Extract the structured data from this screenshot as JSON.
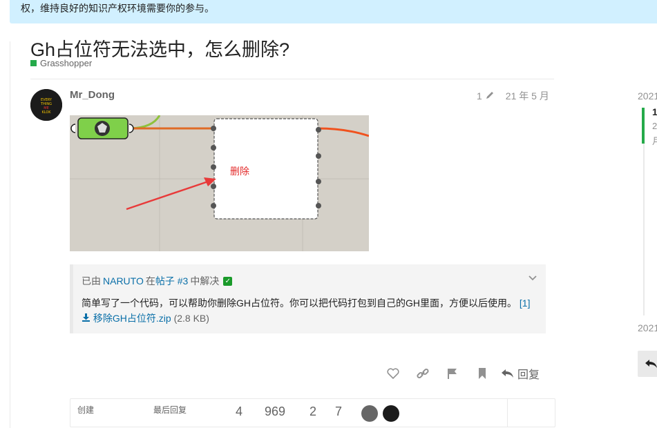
{
  "banner": {
    "text": "权，维持良好的知识产权环境需要你的参与。"
  },
  "topic": {
    "title": "Gh占位符无法选中，怎么删除?",
    "category": "Grasshopper",
    "category_color": "#25aa4a"
  },
  "post": {
    "username": "Mr_Dong",
    "edits": "1",
    "date": "21 年 5 月",
    "avatar_text": [
      "EVERY",
      "THING",
      "ME",
      "KLOK"
    ],
    "image_annotation": "删除"
  },
  "solution": {
    "prefix": "已由",
    "user": "NARUTO",
    "mid": "在",
    "post_link": "帖子 #3",
    "suffix": "中解决",
    "text": "简单写了一个代码，可以帮助你删除GH占位符。你可以把代码打包到自己的GH里面，方便以后使用。",
    "footnote": "[1]",
    "attachment": "移除GH占位符.zip",
    "size": "(2.8 KB)"
  },
  "actions": {
    "reply_label": "回复"
  },
  "stats": {
    "created_label": "创建",
    "last_reply_label": "最后回复",
    "values": [
      "4",
      "969",
      "2",
      "7"
    ]
  },
  "timeline": {
    "start": "2021",
    "end": "2021",
    "position": "1",
    "sub1": "2",
    "sub2": "月"
  },
  "colors": {
    "accent": "#25aa4a",
    "link": "#0a6fa8",
    "banner": "#d1f0ff"
  }
}
